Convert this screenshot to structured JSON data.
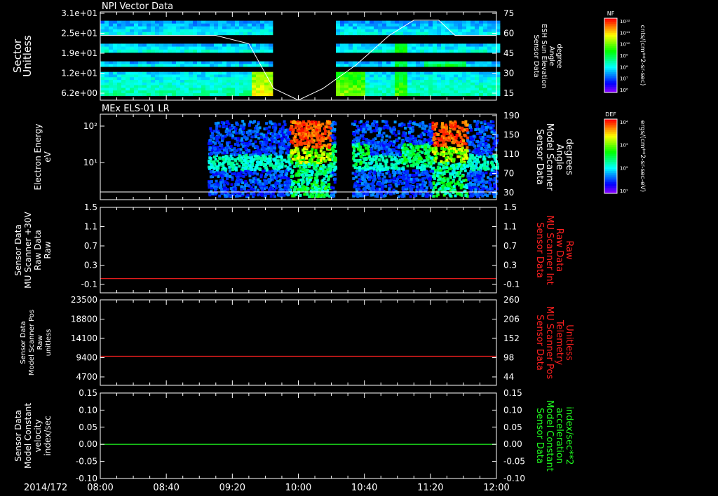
{
  "date_label": "2014/172",
  "time_ticks": [
    "08:00",
    "08:40",
    "09:20",
    "10:00",
    "10:40",
    "11:20",
    "12:00"
  ],
  "panels": [
    {
      "title": "NPI Vector Data",
      "left_label": [
        "Sector",
        "Unitless"
      ],
      "left_ticks": [
        "3.1e+01",
        "2.5e+01",
        "1.9e+01",
        "1.2e+01",
        "6.2e+00"
      ],
      "right_ticks": [
        "75",
        "60",
        "45",
        "30",
        "15"
      ],
      "right_label": [
        "Sensor Data",
        "ESH Sun Elevation",
        "Angle",
        "degree"
      ]
    },
    {
      "title": "MEx ELS-01 LR",
      "left_label": [
        "Electron Energy",
        "eV"
      ],
      "left_ticks": [
        "10²",
        "10¹"
      ],
      "right_ticks": [
        "190",
        "150",
        "110",
        "70",
        "30"
      ],
      "right_label": [
        "Sensor Data",
        "Model Scanner",
        "Angle",
        "degrees"
      ]
    },
    {
      "title": "",
      "left_label": [
        "Sensor Data",
        "MU Scanner +30V",
        "Raw Data",
        "Raw"
      ],
      "left_ticks": [
        "1.5",
        "1.1",
        "0.7",
        "0.3",
        "-0.1"
      ],
      "right_ticks": [
        "1.5",
        "1.1",
        "0.7",
        "0.3",
        "-0.1"
      ],
      "right_label": [
        "Sensor Data",
        "MU Scanner Int",
        "Raw Data",
        "Raw"
      ],
      "right_label_color": "#ff2020"
    },
    {
      "title": "",
      "left_label": [
        "Sensor Data",
        "Model Scanner Pos",
        "Raw",
        "unitless"
      ],
      "left_ticks": [
        "23500",
        "18800",
        "14100",
        "9400",
        "4700"
      ],
      "right_ticks": [
        "260",
        "206",
        "152",
        "98",
        "44"
      ],
      "right_label": [
        "Sensor Data",
        "MU Scanner Pos",
        "Telemetry",
        "Unitless"
      ],
      "right_label_color": "#ff2020"
    },
    {
      "title": "",
      "left_label": [
        "Sensor Data",
        "Model Constant",
        "velocity",
        "index/sec"
      ],
      "left_ticks": [
        "0.15",
        "0.10",
        "0.05",
        "0.00",
        "-0.05",
        "-0.10"
      ],
      "right_ticks": [
        "0.15",
        "0.10",
        "0.05",
        "0.00",
        "-0.05",
        "-0.10"
      ],
      "right_label": [
        "Sensor Data",
        "Model Constant",
        "acceleration",
        "index/sec**2"
      ],
      "right_label_color": "#20ff20"
    }
  ],
  "colorbars": [
    {
      "tag": "NF",
      "ticks": [
        "10¹²",
        "10¹¹",
        "10¹⁰",
        "10⁹",
        "10⁸",
        "10⁷",
        "10⁶"
      ],
      "unit": "cnts/(cm**2-sr-sec)"
    },
    {
      "tag": "DEF",
      "ticks": [
        "10⁴",
        "10³",
        "10²",
        "10¹"
      ],
      "unit": "ergs/(cm**2-sr-sec-eV)"
    }
  ],
  "chart_data": [
    {
      "type": "heatmap",
      "title": "NPI Vector Data",
      "ylabel": "Sector Unitless",
      "y2label": "Sensor Data ESH Sun Elevation Angle degree",
      "ylim": [
        0,
        31
      ],
      "y2lim": [
        0,
        75
      ],
      "x": [
        "08:00",
        "12:00"
      ],
      "overlay_line": {
        "name": "ESH Sun Elevation Angle",
        "x": [
          "08:00",
          "09:10",
          "09:30",
          "09:45",
          "10:00",
          "10:15",
          "10:35",
          "10:55",
          "11:10",
          "11:25",
          "11:35",
          "12:00"
        ],
        "y": [
          55,
          55,
          48,
          10,
          0,
          10,
          30,
          55,
          68,
          68,
          55,
          55
        ]
      },
      "data_gap": [
        "09:45",
        "10:22"
      ]
    },
    {
      "type": "heatmap",
      "title": "MEx ELS-01 LR",
      "ylabel": "Electron Energy eV",
      "y2label": "Sensor Data Model Scanner Angle degrees",
      "yscale": "log",
      "y2lim": [
        0,
        190
      ],
      "x": [
        "08:00",
        "12:00"
      ],
      "data_gap": [
        "10:22",
        "10:32"
      ]
    },
    {
      "type": "line",
      "ylabel": "Sensor Data MU Scanner +30V Raw Data Raw",
      "ylim": [
        -0.3,
        1.5
      ],
      "series": [
        {
          "x": [
            "08:00",
            "12:00"
          ],
          "y": [
            0,
            0
          ],
          "color": "#ff2020"
        }
      ]
    },
    {
      "type": "line",
      "ylabel": "Sensor Data Model Scanner Pos Raw unitless",
      "ylim": [
        0,
        23500
      ],
      "series": [
        {
          "x": [
            "08:00",
            "12:00"
          ],
          "y": [
            8000,
            8000
          ],
          "color": "#ff2020"
        }
      ]
    },
    {
      "type": "line",
      "ylabel": "Sensor Data Model Constant velocity index/sec",
      "ylim": [
        -0.1,
        0.15
      ],
      "series": [
        {
          "x": [
            "08:00",
            "12:00"
          ],
          "y": [
            0,
            0
          ],
          "color": "#20ff20"
        }
      ]
    }
  ]
}
